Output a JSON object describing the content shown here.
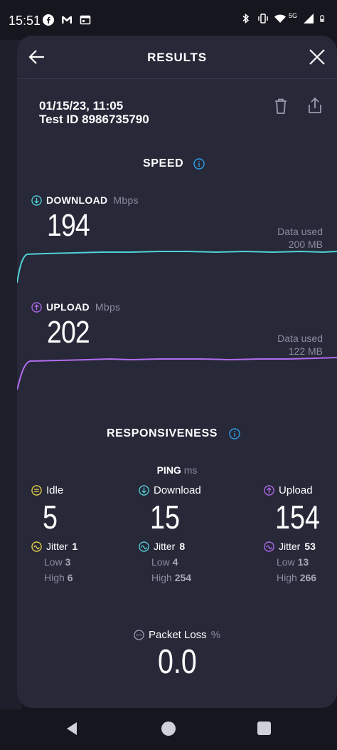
{
  "status": {
    "time": "15:51",
    "network_label": "5G"
  },
  "header": {
    "title": "RESULTS"
  },
  "test": {
    "datetime": "01/15/23, 11:05",
    "test_id": "Test ID 8986735790"
  },
  "speed": {
    "section_title": "SPEED",
    "download": {
      "label": "DOWNLOAD",
      "unit": "Mbps",
      "value": "194",
      "data_used_label": "Data used",
      "data_used": "200 MB",
      "color": "#4fd3d8"
    },
    "upload": {
      "label": "UPLOAD",
      "unit": "Mbps",
      "value": "202",
      "data_used_label": "Data used",
      "data_used": "122 MB",
      "color": "#b36cf0"
    }
  },
  "responsiveness": {
    "section_title": "RESPONSIVENESS",
    "ping_label": "PING",
    "ping_unit": "ms",
    "columns": [
      {
        "label": "Idle",
        "value": "5",
        "jitter_label": "Jitter",
        "jitter": "1",
        "low_label": "Low",
        "low": "3",
        "high_label": "High",
        "high": "6",
        "color": "#e8d34a"
      },
      {
        "label": "Download",
        "value": "15",
        "jitter_label": "Jitter",
        "jitter": "8",
        "low_label": "Low",
        "low": "4",
        "high_label": "High",
        "high": "254",
        "color": "#4fd3d8"
      },
      {
        "label": "Upload",
        "value": "154",
        "jitter_label": "Jitter",
        "jitter": "53",
        "low_label": "Low",
        "low": "13",
        "high_label": "High",
        "high": "266",
        "color": "#b36cf0"
      }
    ],
    "packet_loss_label": "Packet Loss",
    "packet_loss_unit": "%",
    "packet_loss": "0.0"
  },
  "icons": {
    "back": "arrow-left-icon",
    "close": "close-icon",
    "trash": "trash-icon",
    "share": "share-icon",
    "info": "info-icon"
  },
  "colors": {
    "background": "#16161e",
    "card": "#272838",
    "info_accent": "#2b9ee8"
  }
}
